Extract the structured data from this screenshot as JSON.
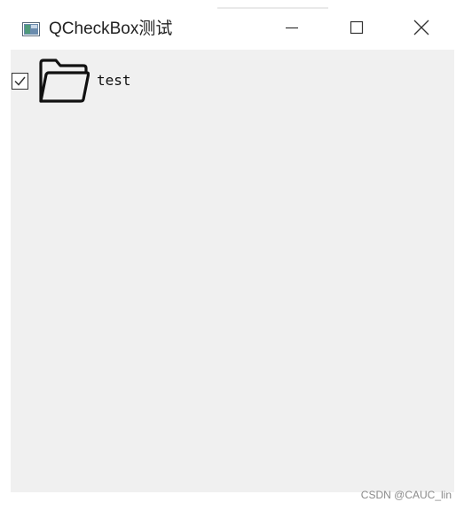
{
  "window": {
    "title": "QCheckBox测试",
    "app_icon": "qt-window-icon",
    "controls": {
      "minimize_icon": "minimize-icon",
      "maximize_icon": "maximize-icon",
      "close_icon": "close-icon"
    }
  },
  "checkbox": {
    "label": "test",
    "checked": true,
    "icon": "folder-icon"
  },
  "watermark": "CSDN @CAUC_lin",
  "colors": {
    "client_background": "#f0f0f0",
    "titlebar_background": "#ffffff",
    "text": "#111111",
    "watermark": "#8a8a8a"
  }
}
